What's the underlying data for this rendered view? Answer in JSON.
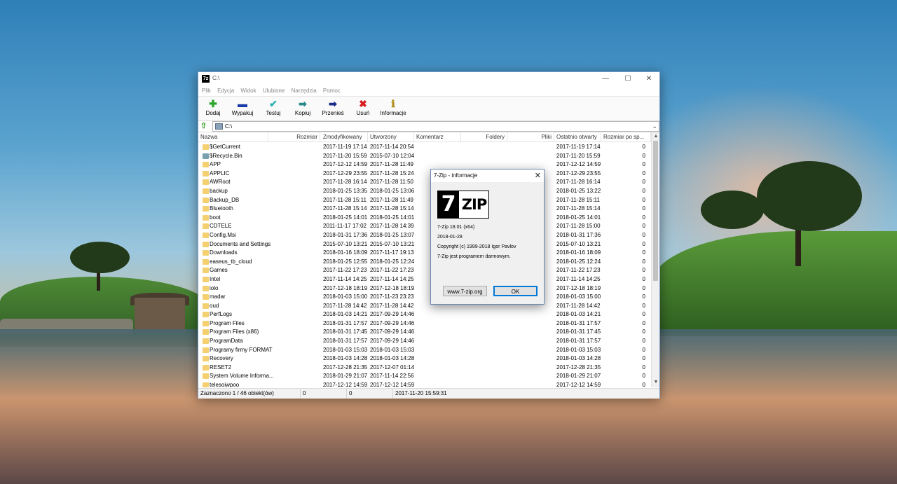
{
  "colors": {
    "accent": "#0078d7",
    "folder": "#f4d070",
    "window_border": "#7a9cc6"
  },
  "window": {
    "title": "C:\\",
    "app_icon_text": "7z",
    "controls": {
      "minimize": "—",
      "maximize": "☐",
      "close": "✕"
    }
  },
  "menu": [
    "Plik",
    "Edycja",
    "Widok",
    "Ulubione",
    "Narzędzia",
    "Pomoc"
  ],
  "toolbar": [
    {
      "label": "Dodaj",
      "icon": "add-icon",
      "glyph": "✚",
      "color": "#2aa52a"
    },
    {
      "label": "Wypakuj",
      "icon": "extract-icon",
      "glyph": "▬",
      "color": "#1a3aa8"
    },
    {
      "label": "Testuj",
      "icon": "test-icon",
      "glyph": "✔",
      "color": "#2ab0b0"
    },
    {
      "label": "Kopiuj",
      "icon": "copy-icon",
      "glyph": "➡",
      "color": "#2a8a8a"
    },
    {
      "label": "Przenieś",
      "icon": "move-icon",
      "glyph": "➡",
      "color": "#1a2a8a"
    },
    {
      "label": "Usuń",
      "icon": "delete-icon",
      "glyph": "✖",
      "color": "#d81e1e"
    },
    {
      "label": "Informacje",
      "icon": "info-icon",
      "glyph": "ℹ",
      "color": "#b08a10"
    }
  ],
  "address": {
    "path": "C:\\"
  },
  "columns": [
    "Nazwa",
    "Rozmiar",
    "Zmodyfikowany",
    "Utworzony",
    "Komentarz",
    "Foldery",
    "Pliki",
    "Ostatnio otwarty",
    "Rozmiar po sp..."
  ],
  "files": [
    {
      "name": "$GetCurrent",
      "modified": "2017-11-19 17:14",
      "created": "2017-11-14 20:54",
      "accessed": "2017-11-19 17:14",
      "packed": "0"
    },
    {
      "name": "$Recycle.Bin",
      "modified": "2017-11-20 15:59",
      "created": "2015-07-10 12:04",
      "accessed": "2017-11-20 15:59",
      "packed": "0",
      "special": true
    },
    {
      "name": "APP",
      "modified": "2017-12-12 14:59",
      "created": "2017-11-28 11:49",
      "accessed": "2017-12-12 14:59",
      "packed": "0"
    },
    {
      "name": "APPLIC",
      "modified": "2017-12-29 23:55",
      "created": "2017-11-28 15:24",
      "accessed": "2017-12-29 23:55",
      "packed": "0"
    },
    {
      "name": "AWRoot",
      "modified": "2017-11-28 16:14",
      "created": "2017-11-28 11:50",
      "accessed": "2017-11-28 16:14",
      "packed": "0"
    },
    {
      "name": "backup",
      "modified": "2018-01-25 13:35",
      "created": "2018-01-25 13:06",
      "accessed": "2018-01-25 13:22",
      "packed": "0"
    },
    {
      "name": "Backup_DB",
      "modified": "2017-11-28 15:11",
      "created": "2017-11-28 11:49",
      "accessed": "2017-11-28 15:11",
      "packed": "0"
    },
    {
      "name": "Bluetooth",
      "modified": "2017-11-28 15:14",
      "created": "2017-11-28 15:14",
      "accessed": "2017-11-28 15:14",
      "packed": "0"
    },
    {
      "name": "boot",
      "modified": "2018-01-25 14:01",
      "created": "2018-01-25 14:01",
      "accessed": "2018-01-25 14:01",
      "packed": "0"
    },
    {
      "name": "CDTELE",
      "modified": "2011-11-17 17:02",
      "created": "2017-11-28 14:39",
      "accessed": "2017-11-28 15:00",
      "packed": "0"
    },
    {
      "name": "Config.Msi",
      "modified": "2018-01-31 17:36",
      "created": "2018-01-25 13:07",
      "accessed": "2018-01-31 17:36",
      "packed": "0"
    },
    {
      "name": "Documents and Settings",
      "modified": "2015-07-10 13:21",
      "created": "2015-07-10 13:21",
      "accessed": "2015-07-10 13:21",
      "packed": "0"
    },
    {
      "name": "Downloads",
      "modified": "2018-01-16 18:09",
      "created": "2017-11-17 19:13",
      "accessed": "2018-01-16 18:09",
      "packed": "0"
    },
    {
      "name": "easeus_tb_cloud",
      "modified": "2018-01-25 12:55",
      "created": "2018-01-25 12:24",
      "accessed": "2018-01-25 12:24",
      "packed": "0"
    },
    {
      "name": "Games",
      "modified": "2017-11-22 17:23",
      "created": "2017-11-22 17:23",
      "accessed": "2017-11-22 17:23",
      "packed": "0"
    },
    {
      "name": "Intel",
      "modified": "2017-11-14 14:25",
      "created": "2017-11-14 14:25",
      "accessed": "2017-11-14 14:25",
      "packed": "0"
    },
    {
      "name": "iolo",
      "modified": "2017-12-18 18:19",
      "created": "2017-12-18 18:19",
      "accessed": "2017-12-18 18:19",
      "packed": "0"
    },
    {
      "name": "madar",
      "modified": "2018-01-03 15:00",
      "created": "2017-11-23 23:23",
      "accessed": "2018-01-03 15:00",
      "packed": "0"
    },
    {
      "name": "oud",
      "modified": "2017-11-28 14:42",
      "created": "2017-11-28 14:42",
      "accessed": "2017-11-28 14:42",
      "packed": "0"
    },
    {
      "name": "PerfLogs",
      "modified": "2018-01-03 14:21",
      "created": "2017-09-29 14:46",
      "accessed": "2018-01-03 14:21",
      "packed": "0"
    },
    {
      "name": "Program Files",
      "modified": "2018-01-31 17:57",
      "created": "2017-09-29 14:46",
      "accessed": "2018-01-31 17:57",
      "packed": "0"
    },
    {
      "name": "Program Files (x86)",
      "modified": "2018-01-31 17:45",
      "created": "2017-09-29 14:46",
      "accessed": "2018-01-31 17:45",
      "packed": "0"
    },
    {
      "name": "ProgramData",
      "modified": "2018-01-31 17:57",
      "created": "2017-09-29 14:46",
      "accessed": "2018-01-31 17:57",
      "packed": "0"
    },
    {
      "name": "Programy firmy FORMAT",
      "modified": "2018-01-03 15:03",
      "created": "2018-01-03 15:03",
      "accessed": "2018-01-03 15:03",
      "packed": "0"
    },
    {
      "name": "Recovery",
      "modified": "2018-01-03 14:28",
      "created": "2018-01-03 14:28",
      "accessed": "2018-01-03 14:28",
      "packed": "0"
    },
    {
      "name": "RESET2",
      "modified": "2017-12-28 21:35",
      "created": "2017-12-07 01:14",
      "accessed": "2017-12-28 21:35",
      "packed": "0"
    },
    {
      "name": "System Volume Informa...",
      "modified": "2018-01-29 21:07",
      "created": "2017-11-14 22:56",
      "accessed": "2018-01-29 21:07",
      "packed": "0"
    },
    {
      "name": "telesoiwpoo",
      "modified": "2017-12-12 14:59",
      "created": "2017-12-12 14:59",
      "accessed": "2017-12-12 14:59",
      "packed": "0"
    }
  ],
  "status": {
    "selection": "Zaznaczono 1 / 46 obiekt(ów)",
    "size": "0",
    "packed": "0",
    "date": "2017-11-20 15:59:31"
  },
  "about": {
    "title": "7-Zip - informacje",
    "close_glyph": "✕",
    "logo_left": "7",
    "logo_right": "ZIP",
    "version": "7-Zip 18.01 (x64)",
    "date": "2018-01-28",
    "copyright": "Copyright (c) 1999-2018 Igor Pavlov",
    "freeware": "7-Zip jest programem darmowym.",
    "site_button": "www.7-zip.org",
    "ok_button": "OK"
  }
}
